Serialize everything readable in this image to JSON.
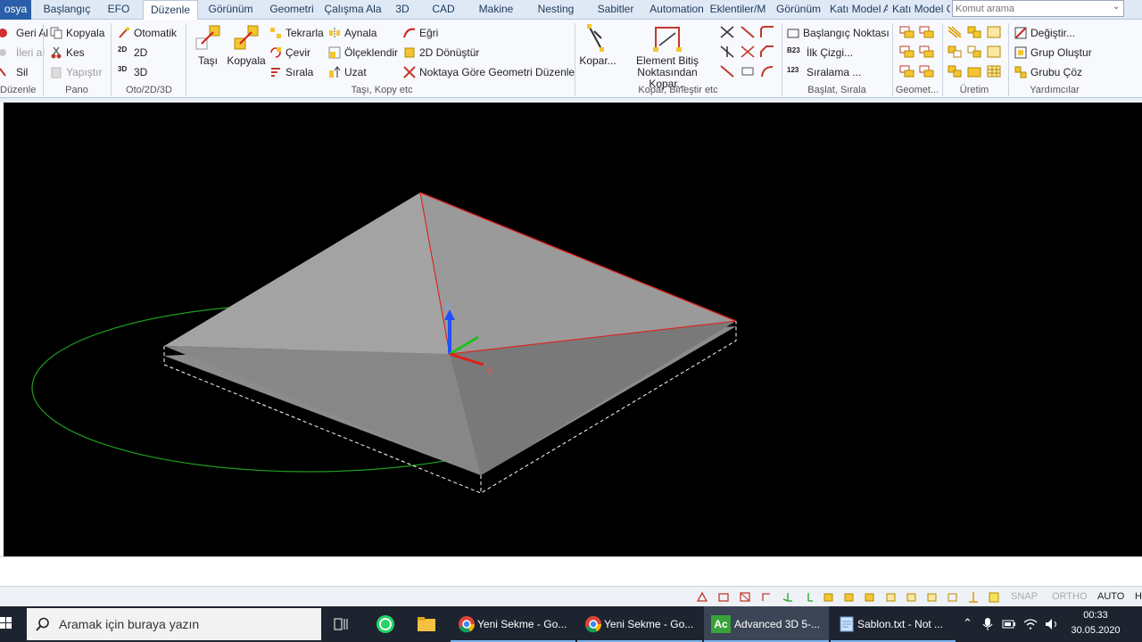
{
  "tabs": [
    {
      "id": "file",
      "label": "osya"
    },
    {
      "id": "baslangic",
      "label": "Başlangıç"
    },
    {
      "id": "efo",
      "label": "EFO"
    },
    {
      "id": "duzenle",
      "label": "Düzenle"
    },
    {
      "id": "gorunum",
      "label": "Görünüm"
    },
    {
      "id": "geometri",
      "label": "Geometri"
    },
    {
      "id": "calisma",
      "label": "Çalışma Ala"
    },
    {
      "id": "3d",
      "label": "3D"
    },
    {
      "id": "cad",
      "label": "CAD"
    },
    {
      "id": "makine",
      "label": "Makine"
    },
    {
      "id": "nesting",
      "label": "Nesting"
    },
    {
      "id": "sabitler",
      "label": "Sabitler"
    },
    {
      "id": "automation",
      "label": "Automation"
    },
    {
      "id": "eklentiler",
      "label": "Eklentiler/M"
    },
    {
      "id": "gorunum2",
      "label": "Görünüm"
    },
    {
      "id": "katimodel1",
      "label": "Katı Model A"
    },
    {
      "id": "katimodel2",
      "label": "Katı Model G"
    }
  ],
  "search": {
    "placeholder": "Komut arama"
  },
  "ribbon": {
    "duzenle_group": {
      "geri_al": "Geri Al",
      "ileri_al": "İleri al",
      "sil": "Sil",
      "label": "Düzenle"
    },
    "pano": {
      "kopyala": "Kopyala",
      "kes": "Kes",
      "yapistir": "Yapıştır",
      "label": "Pano"
    },
    "oto2d3d": {
      "otomatik": "Otomatik",
      "2d": "2D",
      "3d": "3D",
      "label": "Oto/2D/3D",
      "icon_2d": "2D",
      "icon_3d": "3D"
    },
    "tasi_kopyala": {
      "tasi": "Taşı",
      "kopyala": "Kopyala",
      "tekrarla": "Tekrarla",
      "cevir": "Çevir",
      "sirala": "Sırala",
      "aynala": "Aynala",
      "olceklendir": "Ölçeklendir",
      "uzat": "Uzat",
      "egri": "Eğri",
      "donustur": "2D Dönüştür",
      "noktaya": "Noktaya Göre Geometri Düzenle",
      "label": "Taşı, Kopy etc"
    },
    "kopar": {
      "kopar": "Kopar...",
      "element_bitis": "Element Bitiş Noktasından Kopar...",
      "label": "Kopar, Birleştir etc"
    },
    "baslat": {
      "baslangic_noktasi": "Başlangıç Noktası",
      "ilk_cizgi": "İlk Çizgi...",
      "siralama": "Sıralama ...",
      "label": "Başlat, Sırala",
      "icon_ilk": "B23",
      "icon_sira": "123"
    },
    "geometri": {
      "label": "Geomet..."
    },
    "uretim": {
      "label": "Üretim"
    },
    "yardimcilar": {
      "degistir": "Değiştir...",
      "grup_olustur": "Grup Oluştur",
      "grubu_coz": "Grubu Çöz",
      "label": "Yardımcılar"
    }
  },
  "viewport": {
    "axes": {
      "z": "Z",
      "x": "X"
    },
    "colors": {
      "background": "#000000",
      "face_light": "#a3a3a3",
      "face_mid": "#8c8c8c",
      "face_dark": "#797979",
      "edge": "#e0201a",
      "circle": "#1f9b1f",
      "bbox": "#ffffff"
    }
  },
  "statusbar": {
    "snap": "SNAP",
    "ortho": "ORTHO",
    "auto": "AUTO",
    "extra": "H"
  },
  "taskbar": {
    "search_placeholder": "Aramak için buraya yazın",
    "apps": [
      {
        "label": "Yeni Sekme - Go...",
        "icon": "chrome-icon"
      },
      {
        "label": "Yeni Sekme - Go...",
        "icon": "chrome-icon"
      },
      {
        "label": "Advanced 3D 5-...",
        "icon": "advanced-3d-icon",
        "badge": "Ac"
      },
      {
        "label": "Sablon.txt - Not ...",
        "icon": "notepad-icon"
      }
    ],
    "time": "00:33",
    "date": "30.05.2020"
  }
}
